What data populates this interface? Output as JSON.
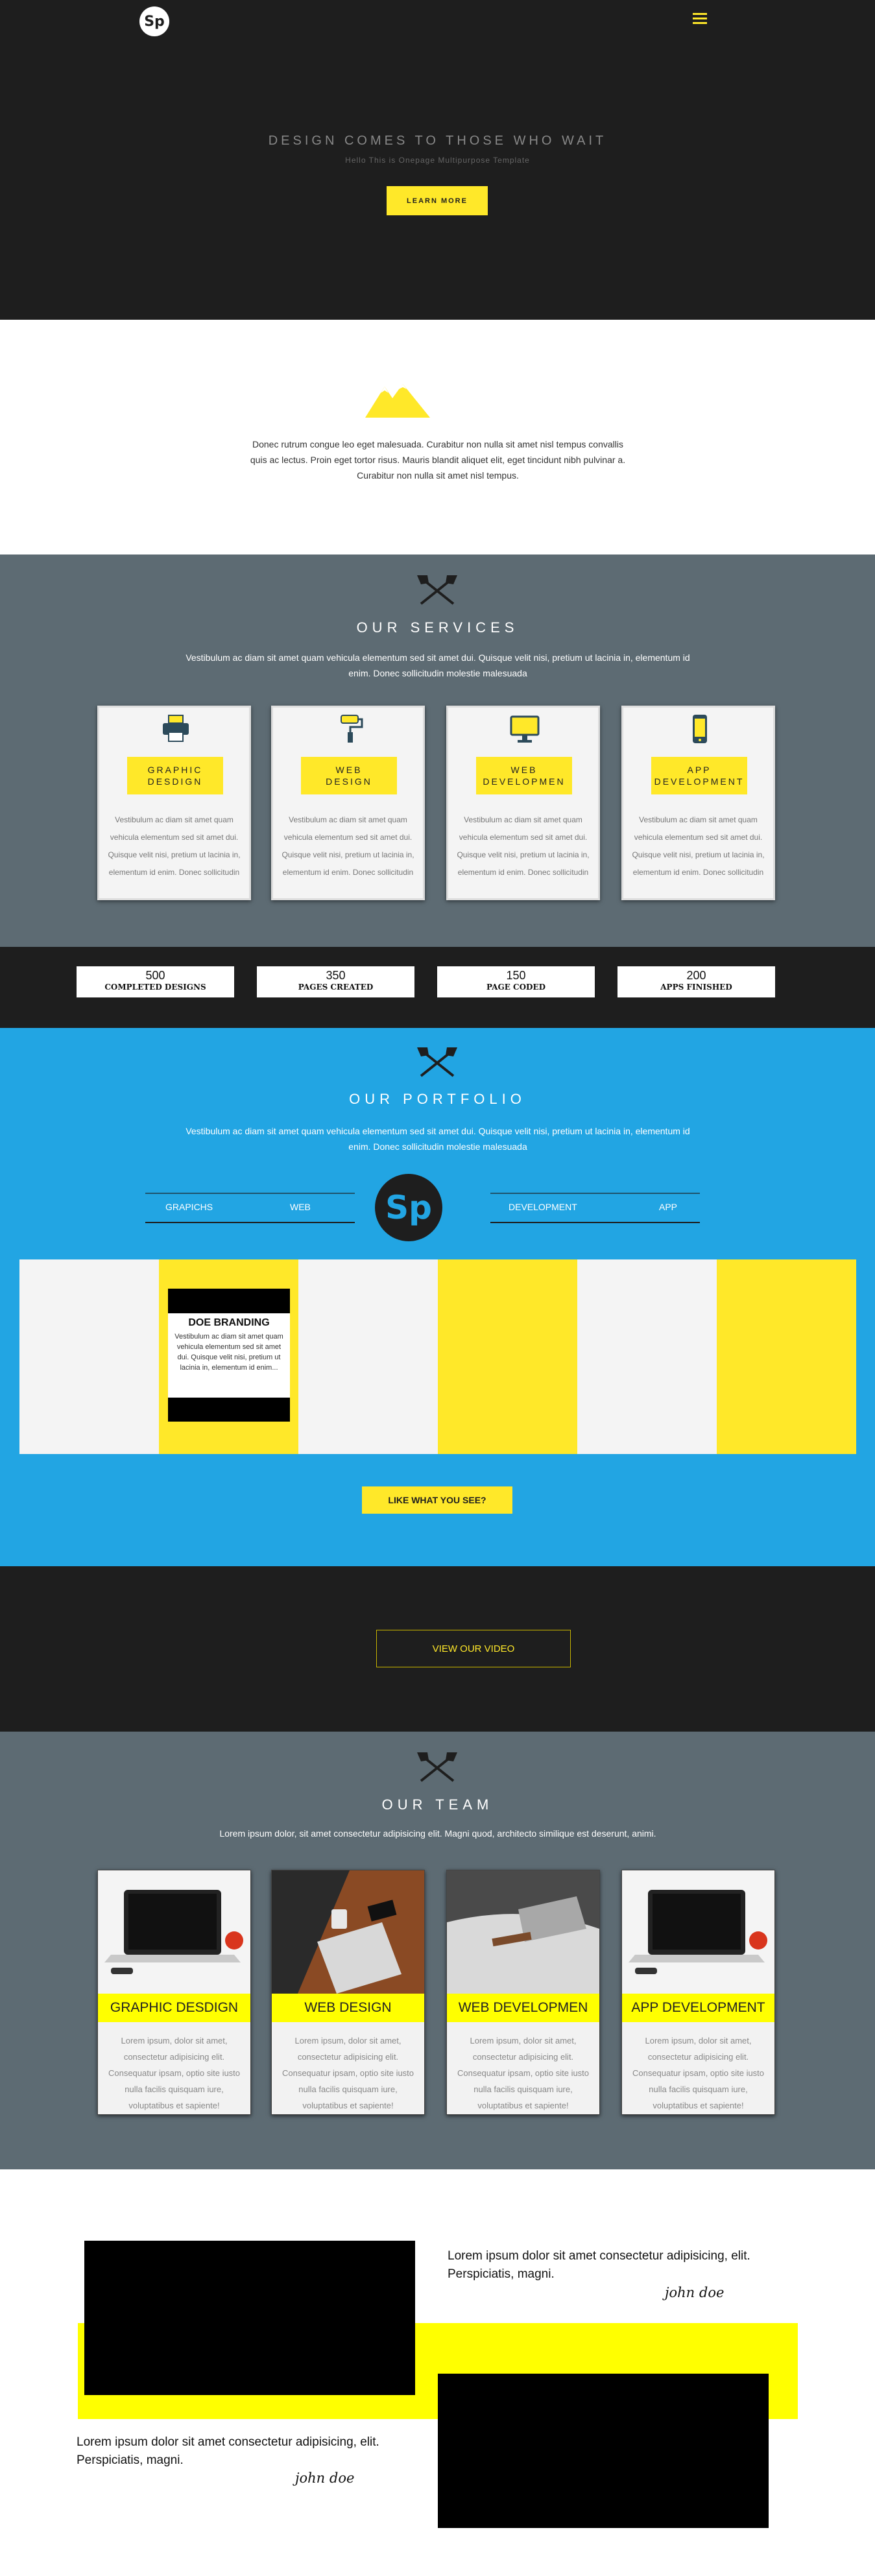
{
  "header": {
    "logo_text": "Sp",
    "menu_icon": "hamburger-icon"
  },
  "hero": {
    "title": "DESIGN COMES TO THOSE WHO WAIT",
    "subtitle": "Hello This is Onepage Multipurpose Template",
    "button": "LEARN MORE"
  },
  "about": {
    "icon": "mountain-icon",
    "text": "Donec rutrum congue leo eget malesuada. Curabitur non nulla sit amet nisl tempus convallis quis ac lectus. Proin eget tortor risus. Mauris blandit aliquet elit, eget tincidunt nibh pulvinar a. Curabitur non nulla sit amet nisl tempus."
  },
  "services": {
    "title": "OUR SERVICES",
    "description": "Vestibulum ac diam sit amet quam vehicula elementum sed sit amet dui. Quisque velit nisi, pretium ut lacinia in, elementum id enim. Donec sollicitudin molestie malesuada",
    "cards": [
      {
        "icon": "printer-icon",
        "label": "GRAPHIC\nDESDIGN",
        "text": "Vestibulum ac diam sit amet quam vehicula elementum sed sit amet dui. Quisque velit nisi, pretium ut lacinia in, elementum id enim. Donec sollicitudin"
      },
      {
        "icon": "paint-roller-icon",
        "label": "WEB\nDESIGN",
        "text": "Vestibulum ac diam sit amet quam vehicula elementum sed sit amet dui. Quisque velit nisi, pretium ut lacinia in, elementum id enim. Donec sollicitudin"
      },
      {
        "icon": "monitor-icon",
        "label": "WEB\nDEVELOPMEN",
        "text": "Vestibulum ac diam sit amet quam vehicula elementum sed sit amet dui. Quisque velit nisi, pretium ut lacinia in, elementum id enim. Donec sollicitudin"
      },
      {
        "icon": "phone-icon",
        "label": "APP\nDEVELOPMENT",
        "text": "Vestibulum ac diam sit amet quam vehicula elementum sed sit amet dui. Quisque velit nisi, pretium ut lacinia in, elementum id enim. Donec sollicitudin"
      }
    ]
  },
  "stats": [
    {
      "value": "500",
      "label": "COMPLETED DESIGNS"
    },
    {
      "value": "350",
      "label": "PAGES CREATED"
    },
    {
      "value": "150",
      "label": "PAGE CODED"
    },
    {
      "value": "200",
      "label": "APPS FINISHED"
    }
  ],
  "portfolio": {
    "title": "OUR PORTFOLIO",
    "description": "Vestibulum ac diam sit amet quam vehicula elementum sed sit amet dui. Quisque velit nisi, pretium ut lacinia in, elementum id enim. Donec sollicitudin molestie malesuada",
    "tabs": [
      "GRAPICHS",
      "WEB",
      "DEVELOPMENT",
      "APP"
    ],
    "logo_text": "Sp",
    "item": {
      "title": "DOE BRANDING",
      "text": "Vestibulum ac diam sit amet quam vehicula elementum sed sit amet dui. Quisque velit nisi, pretium ut lacinia in, elementum id enim..."
    },
    "button": "LIKE WHAT YOU SEE?"
  },
  "video": {
    "button": "VIEW OUR VIDEO"
  },
  "team": {
    "title": "OUR TEAM",
    "description": "Lorem ipsum dolor, sit amet consectetur adipisicing elit. Magni quod, architecto similique est deserunt, animi.",
    "members": [
      {
        "label": "GRAPHIC DESDIGN",
        "text": "Lorem ipsum, dolor sit amet, consectetur adipisicing elit. Consequatur ipsam, optio site iusto nulla facilis quisquam iure, voluptatibus et sapiente!"
      },
      {
        "label": "WEB DESIGN",
        "text": "Lorem ipsum, dolor sit amet, consectetur adipisicing elit. Consequatur ipsam, optio site iusto nulla facilis quisquam iure, voluptatibus et sapiente!"
      },
      {
        "label": "WEB DEVELOPMEN",
        "text": "Lorem ipsum, dolor sit amet, consectetur adipisicing elit. Consequatur ipsam, optio site iusto nulla facilis quisquam iure, voluptatibus et sapiente!"
      },
      {
        "label": "APP DEVELOPMENT",
        "text": "Lorem ipsum, dolor sit amet, consectetur adipisicing elit. Consequatur ipsam, optio site iusto nulla facilis quisquam iure, voluptatibus et sapiente!"
      }
    ]
  },
  "testimonials": [
    {
      "quote": "Lorem ipsum dolor sit amet consectetur adipisicing, elit. Perspiciatis, magni.",
      "author": "john doe"
    },
    {
      "quote": "Lorem ipsum dolor sit amet consectetur adipisicing, elit. Perspiciatis, magni.",
      "author": "john doe"
    }
  ],
  "colors": {
    "dark": "#1e1e1e",
    "accent": "#ffe829",
    "slate": "#5d6b73",
    "blue": "#22a5e3"
  }
}
